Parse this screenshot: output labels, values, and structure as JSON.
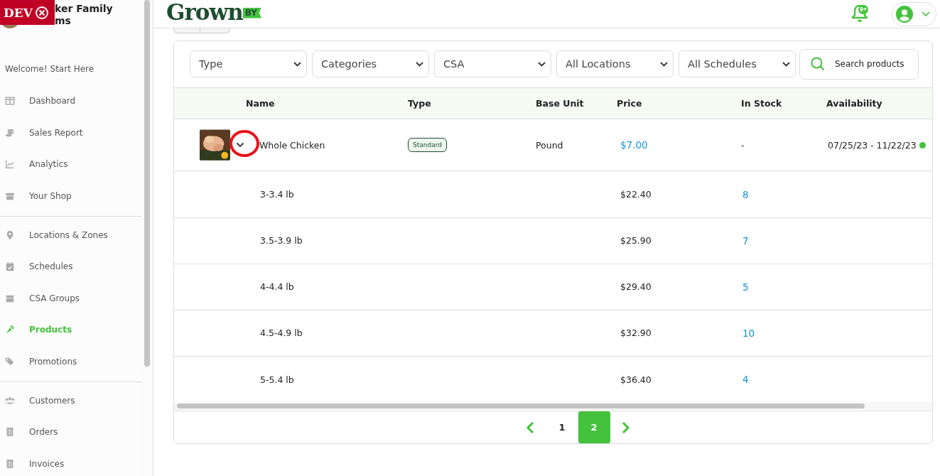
{
  "dev_badge": {
    "label": "DEV"
  },
  "sidebar": {
    "shop_name": [
      "ker Family",
      "ms"
    ],
    "welcome": "Welcome! Start Here",
    "sections": [
      [
        {
          "label": "Dashboard",
          "selected": false
        },
        {
          "label": "Sales Report",
          "selected": false
        },
        {
          "label": "Analytics",
          "selected": false
        },
        {
          "label": "Your Shop",
          "selected": false
        }
      ],
      [
        {
          "label": "Locations & Zones",
          "selected": false
        },
        {
          "label": "Schedules",
          "selected": false
        },
        {
          "label": "CSA Groups",
          "selected": false
        },
        {
          "label": "Products",
          "selected": true
        },
        {
          "label": "Promotions",
          "selected": false
        }
      ],
      [
        {
          "label": "Customers",
          "selected": false
        },
        {
          "label": "Orders",
          "selected": false
        },
        {
          "label": "Invoices",
          "selected": false
        }
      ]
    ]
  },
  "header": {
    "logo": "Grown",
    "logo_tag": "BY",
    "notifications": "9+"
  },
  "filters": [
    "Type",
    "Categories",
    "CSA",
    "All Locations",
    "All Schedules"
  ],
  "search": {
    "placeholder": "Search products"
  },
  "table": {
    "columns": [
      "Name",
      "Type",
      "Base Unit",
      "Price",
      "In Stock",
      "Availability"
    ],
    "product": {
      "name": "Whole Chicken",
      "expanded": true,
      "highlighted": true,
      "type": "Standard",
      "base_unit": "Pound",
      "price": "$7.00",
      "in_stock": "-",
      "availability": "07/25/23 - 11/22/23",
      "color": "#44c23c"
    },
    "variants": [
      {
        "name": "3-3.4 lb",
        "price": "$22.40",
        "in_stock": "8"
      },
      {
        "name": "3.5-3.9 lb",
        "price": "$25.90",
        "in_stock": "7"
      },
      {
        "name": "4-4.4 lb",
        "price": "$29.40",
        "in_stock": "5"
      },
      {
        "name": "4.5-4.9 lb",
        "price": "$32.90",
        "in_stock": "10"
      },
      {
        "name": "5-5.4 lb",
        "price": "$36.40",
        "in_stock": "4"
      }
    ]
  },
  "pagination": {
    "pages": [
      {
        "label": "1",
        "selected": false
      },
      {
        "label": "2",
        "selected": true
      }
    ]
  }
}
